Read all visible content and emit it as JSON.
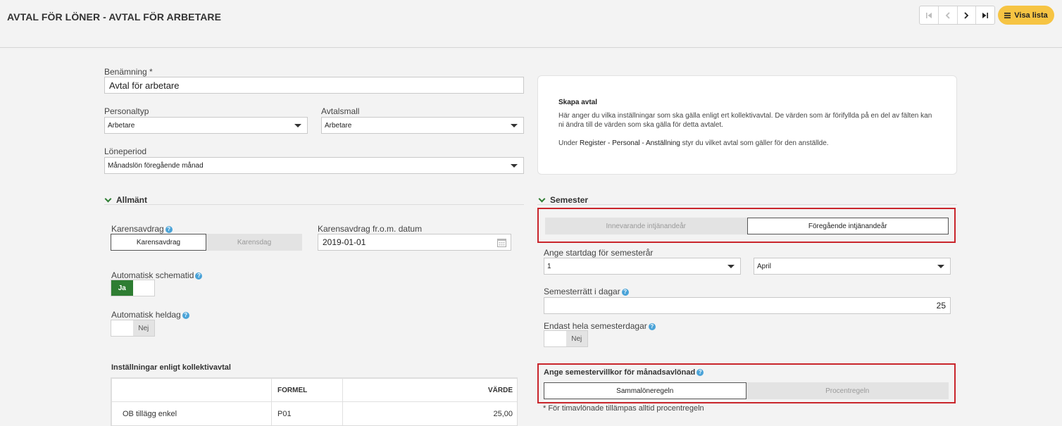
{
  "header": {
    "title": "AVTAL FÖR LÖNER - AVTAL FÖR ARBETARE",
    "nav": {
      "first": "⏮",
      "prev": "‹",
      "next": "›",
      "last": "⏭"
    },
    "visa_lista": "Visa lista"
  },
  "form": {
    "benamning_label": "Benämning *",
    "benamning_value": "Avtal för arbetare",
    "personaltyp_label": "Personaltyp",
    "personaltyp_value": "Arbetare",
    "avtalsmall_label": "Avtalsmall",
    "avtalsmall_value": "Arbetare",
    "loneperiod_label": "Löneperiod",
    "loneperiod_value": "Månadslön föregående månad"
  },
  "info": {
    "title": "Skapa avtal",
    "text1": "Här anger du vilka inställningar som ska gälla enligt ert kollektivavtal. De värden som är förifyllda på en del av fälten kan ni ändra till de värden som ska gälla för detta avtalet.",
    "text2_pre": "Under ",
    "text2_bold": "Register - Personal - Anställning",
    "text2_post": " styr du vilket avtal som gäller för den anställde."
  },
  "allmant": {
    "title": "Allmänt",
    "karensavdrag_label": "Karensavdrag",
    "karensavdrag_opt1": "Karensavdrag",
    "karensavdrag_opt2": "Karensdag",
    "karens_datum_label": "Karensavdrag fr.o.m. datum",
    "karens_datum_value": "2019-01-01",
    "auto_schema_label": "Automatisk schematid",
    "auto_schema_value": "Ja",
    "auto_heldag_label": "Automatisk heldag",
    "auto_heldag_value": "Nej",
    "kollektiv_title": "Inställningar enligt kollektivavtal",
    "table": {
      "headers": [
        "",
        "FORMEL",
        "VÄRDE"
      ],
      "rows": [
        {
          "name": "OB tillägg enkel",
          "formel": "P01",
          "varde": "25,00"
        }
      ]
    }
  },
  "semester": {
    "title": "Semester",
    "intj_opt1": "Innevarande intjänandeår",
    "intj_opt2": "Föregående intjänandeår",
    "startdag_label": "Ange startdag för semesterår",
    "startdag_day": "1",
    "startdag_month": "April",
    "ratt_label": "Semesterrätt i dagar",
    "ratt_value": "25",
    "hela_label": "Endast hela semesterdagar",
    "hela_value": "Nej",
    "villkor_label": "Ange semestervillkor för månadsavlönad",
    "villkor_opt1": "Sammalöneregeln",
    "villkor_opt2": "Procentregeln",
    "note": "* För timavlönade tillämpas alltid procentregeln"
  },
  "colors": {
    "accent_green": "#2e7d32",
    "visa_yellow": "#f6c443",
    "highlight_red": "#c9252b",
    "help_blue": "#4aa3d8"
  }
}
